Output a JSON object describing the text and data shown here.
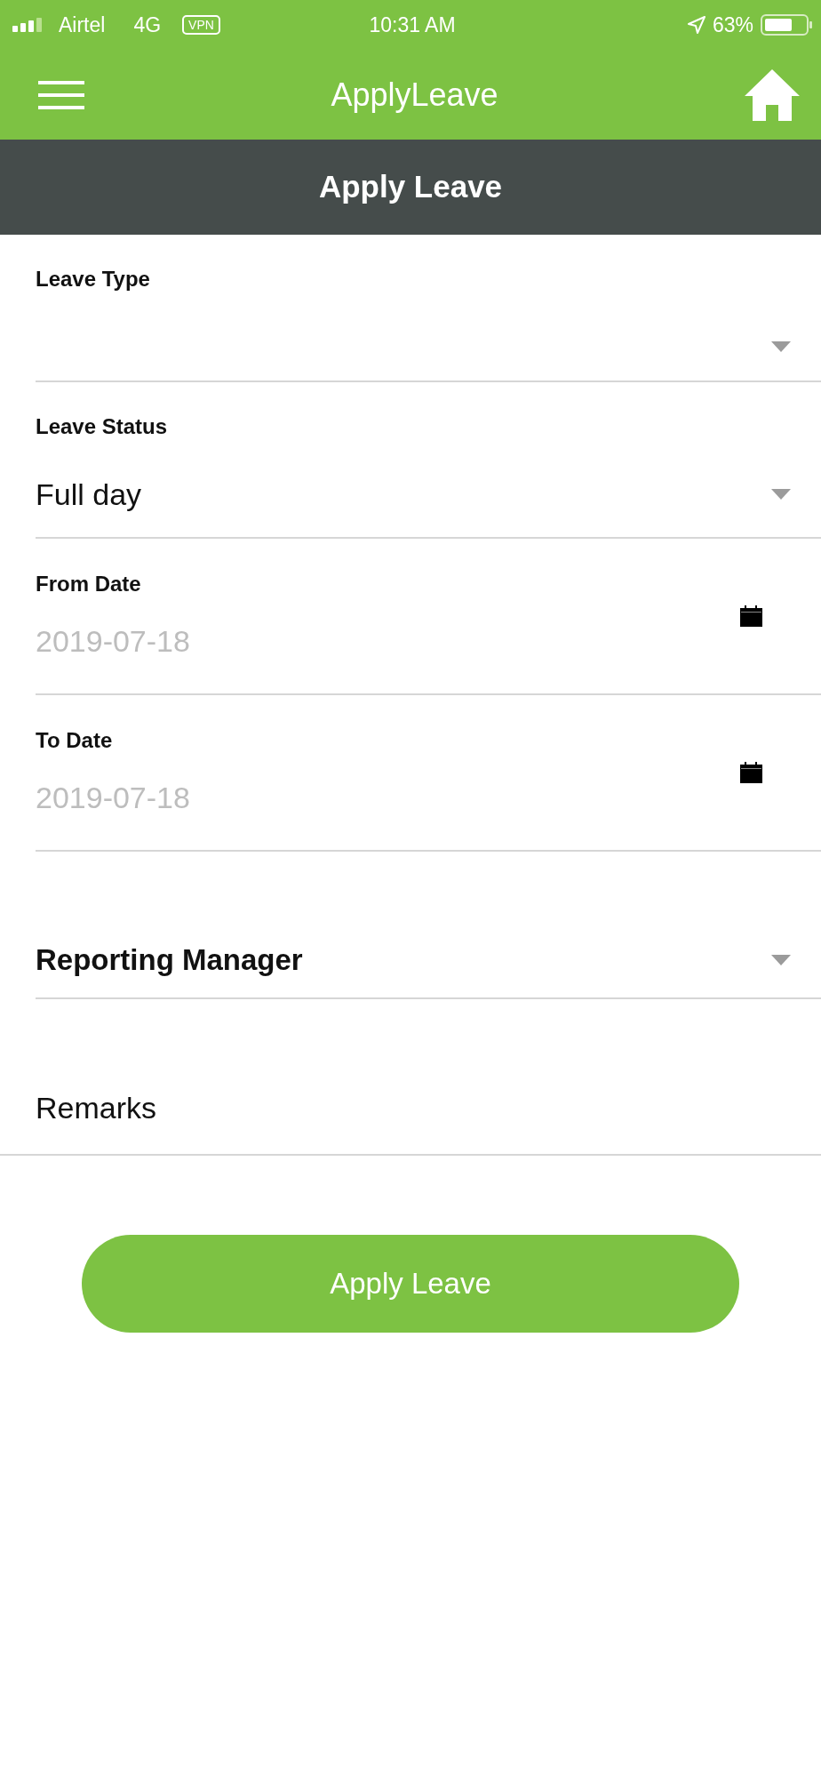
{
  "status_bar": {
    "carrier": "Airtel",
    "network": "4G",
    "vpn": "VPN",
    "time": "10:31 AM",
    "battery": "63%"
  },
  "app_bar": {
    "title": "ApplyLeave"
  },
  "header": {
    "title": "Apply Leave"
  },
  "fields": [
    {
      "kind": "select",
      "label": "Leave Type"
    },
    {
      "kind": "select",
      "label": "Leave Status",
      "value": "Full day"
    },
    {
      "kind": "date",
      "label": "From Date",
      "placeholder": "2019-07-18"
    },
    {
      "kind": "date",
      "label": "To Date",
      "placeholder": "2019-07-18"
    },
    {
      "kind": "picker",
      "label": "Reporting Manager"
    },
    {
      "kind": "remarks",
      "placeholder": "Remarks"
    }
  ],
  "submit": {
    "label": "Apply Leave"
  }
}
